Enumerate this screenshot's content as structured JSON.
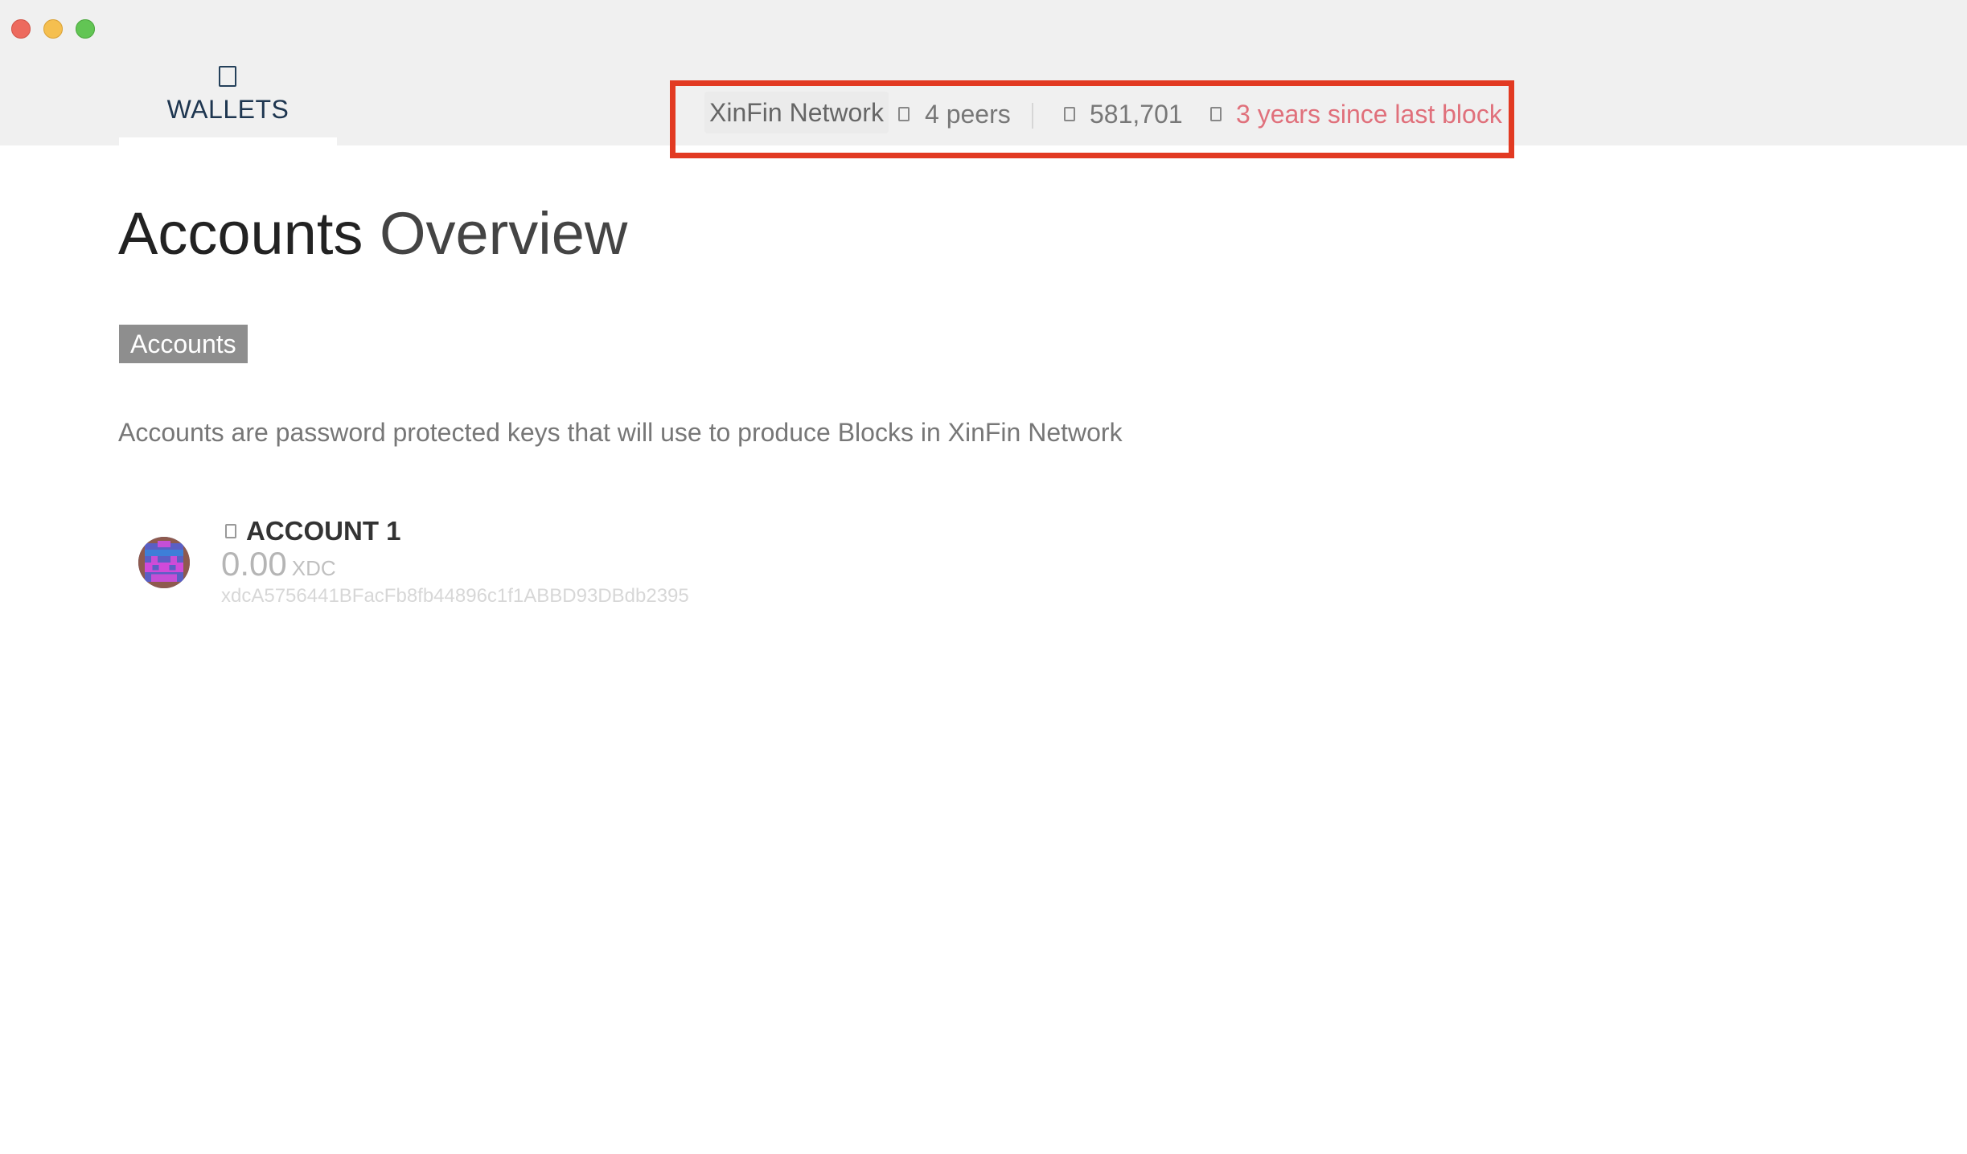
{
  "window": {
    "traffic_lights": [
      "close",
      "minimize",
      "maximize"
    ]
  },
  "nav": {
    "wallets_label": "WALLETS",
    "wallets_icon": "wallet-icon"
  },
  "status": {
    "network": "XinFin Network",
    "peers": "4 peers",
    "peers_icon": "peers-icon",
    "block_number": "581,701",
    "block_icon": "block-icon",
    "last_block": "3 years since last block",
    "last_block_icon": "clock-icon",
    "highlight_color": "#e23a22",
    "warn_color": "#e0707b"
  },
  "main": {
    "title": "Accounts",
    "title_light": "Overview",
    "section_label": "Accounts",
    "description": "Accounts are password protected keys that will use to produce Blocks in XinFin Network",
    "accounts": [
      {
        "name": "ACCOUNT 1",
        "balance": "0.00",
        "unit": "XDC",
        "address": "xdcA5756441BFacFb8fb44896c1f1ABBD93DBdb2395",
        "icon": "lock-icon"
      }
    ]
  }
}
